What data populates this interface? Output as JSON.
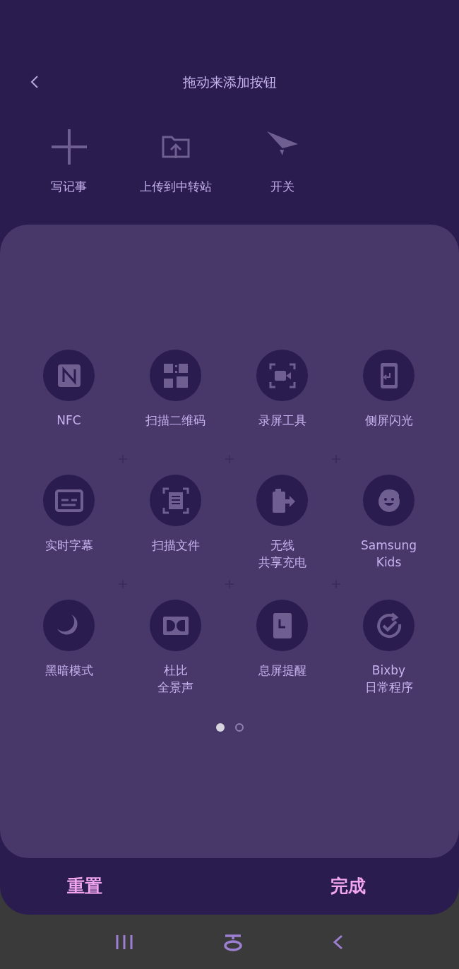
{
  "header": {
    "title": "拖动来添加按钮"
  },
  "top_items": [
    {
      "label": "写记事"
    },
    {
      "label": "上传到中转站"
    },
    {
      "label": "开关"
    }
  ],
  "tiles": [
    {
      "lines": [
        "NFC"
      ]
    },
    {
      "lines": [
        "扫描二维码"
      ]
    },
    {
      "lines": [
        "录屏工具"
      ]
    },
    {
      "lines": [
        "侧屏闪光"
      ]
    },
    {
      "lines": [
        "实时字幕"
      ]
    },
    {
      "lines": [
        "扫描文件"
      ]
    },
    {
      "lines": [
        "无线",
        "共享充电"
      ]
    },
    {
      "lines": [
        "Samsung",
        "Kids"
      ]
    },
    {
      "lines": [
        "黑暗模式"
      ]
    },
    {
      "lines": [
        "杜比",
        "全景声"
      ]
    },
    {
      "lines": [
        "息屏提醒"
      ]
    },
    {
      "lines": [
        "Bixby",
        "日常程序"
      ]
    }
  ],
  "pages": [
    {
      "selected": true
    },
    {
      "selected": false
    }
  ],
  "actions": [
    {
      "label": "重置"
    },
    {
      "label": "完成"
    }
  ]
}
